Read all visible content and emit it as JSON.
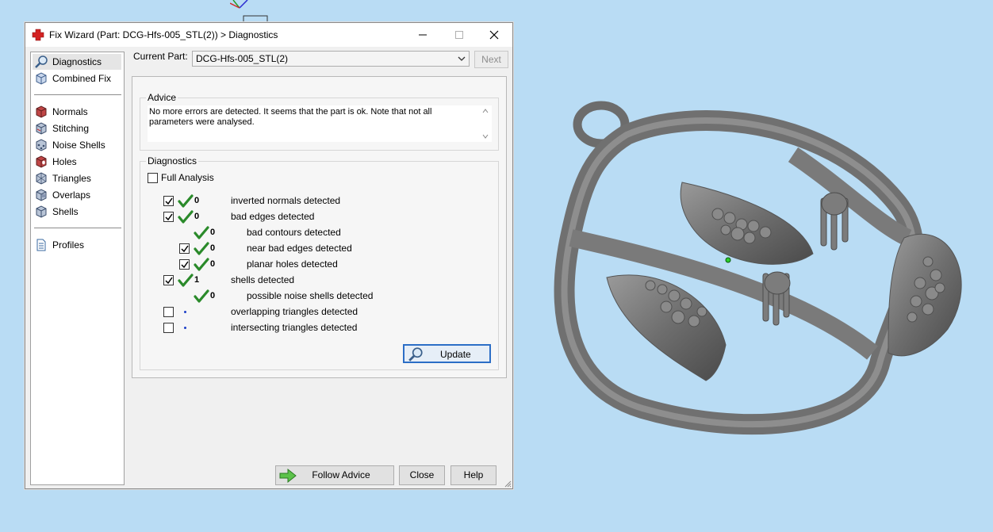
{
  "window": {
    "title": "Fix Wizard (Part: DCG-Hfs-005_STL(2)) > Diagnostics",
    "minimize": "minimize",
    "maximize": "maximize",
    "close": "close"
  },
  "sidebar": {
    "group1": [
      {
        "label": "Diagnostics",
        "icon": "magnifier-icon"
      },
      {
        "label": "Combined Fix",
        "icon": "cube-icon"
      }
    ],
    "group2": [
      {
        "label": "Normals",
        "icon": "normals-cube-icon"
      },
      {
        "label": "Stitching",
        "icon": "stitching-cube-icon"
      },
      {
        "label": "Noise Shells",
        "icon": "noise-cube-icon"
      },
      {
        "label": "Holes",
        "icon": "holes-cube-icon"
      },
      {
        "label": "Triangles",
        "icon": "triangles-cube-icon"
      },
      {
        "label": "Overlaps",
        "icon": "overlaps-cube-icon"
      },
      {
        "label": "Shells",
        "icon": "shells-cube-icon"
      }
    ],
    "group3": [
      {
        "label": "Profiles",
        "icon": "document-icon"
      }
    ]
  },
  "current_part": {
    "label": "Current Part:",
    "value": "DCG-Hfs-005_STL(2)",
    "next_label": "Next"
  },
  "advice": {
    "title": "Advice",
    "text": "No more errors are detected. It seems that the part is ok. Note that not all parameters were analysed."
  },
  "diagnostics": {
    "title": "Diagnostics",
    "full_analysis_label": "Full Analysis",
    "rows": [
      {
        "checkbox": true,
        "checked": true,
        "status": "ok",
        "count": "0",
        "label": "inverted normals detected"
      },
      {
        "checkbox": true,
        "checked": true,
        "status": "ok",
        "count": "0",
        "label": "bad edges detected"
      },
      {
        "checkbox": false,
        "checked": false,
        "status": "ok",
        "count": "0",
        "label": "bad contours detected"
      },
      {
        "checkbox": true,
        "checked": true,
        "status": "ok",
        "count": "0",
        "label": "near bad edges detected"
      },
      {
        "checkbox": true,
        "checked": true,
        "status": "ok",
        "count": "0",
        "label": "planar holes detected"
      },
      {
        "checkbox": true,
        "checked": true,
        "status": "ok",
        "count": "1",
        "label": "shells detected"
      },
      {
        "checkbox": false,
        "checked": false,
        "status": "ok",
        "count": "0",
        "label": "possible noise shells detected"
      },
      {
        "checkbox": true,
        "checked": false,
        "status": "pending",
        "count": "",
        "label": "overlapping triangles detected"
      },
      {
        "checkbox": true,
        "checked": false,
        "status": "pending",
        "count": "",
        "label": "intersecting triangles detected"
      }
    ],
    "update_label": "Update"
  },
  "footer": {
    "follow_advice_label": "Follow Advice",
    "close_label": "Close",
    "help_label": "Help"
  },
  "colors": {
    "viewport_bg": "#b9dcf4",
    "check_green": "#2a8a2a",
    "accent_blue": "#2c6ec6"
  }
}
